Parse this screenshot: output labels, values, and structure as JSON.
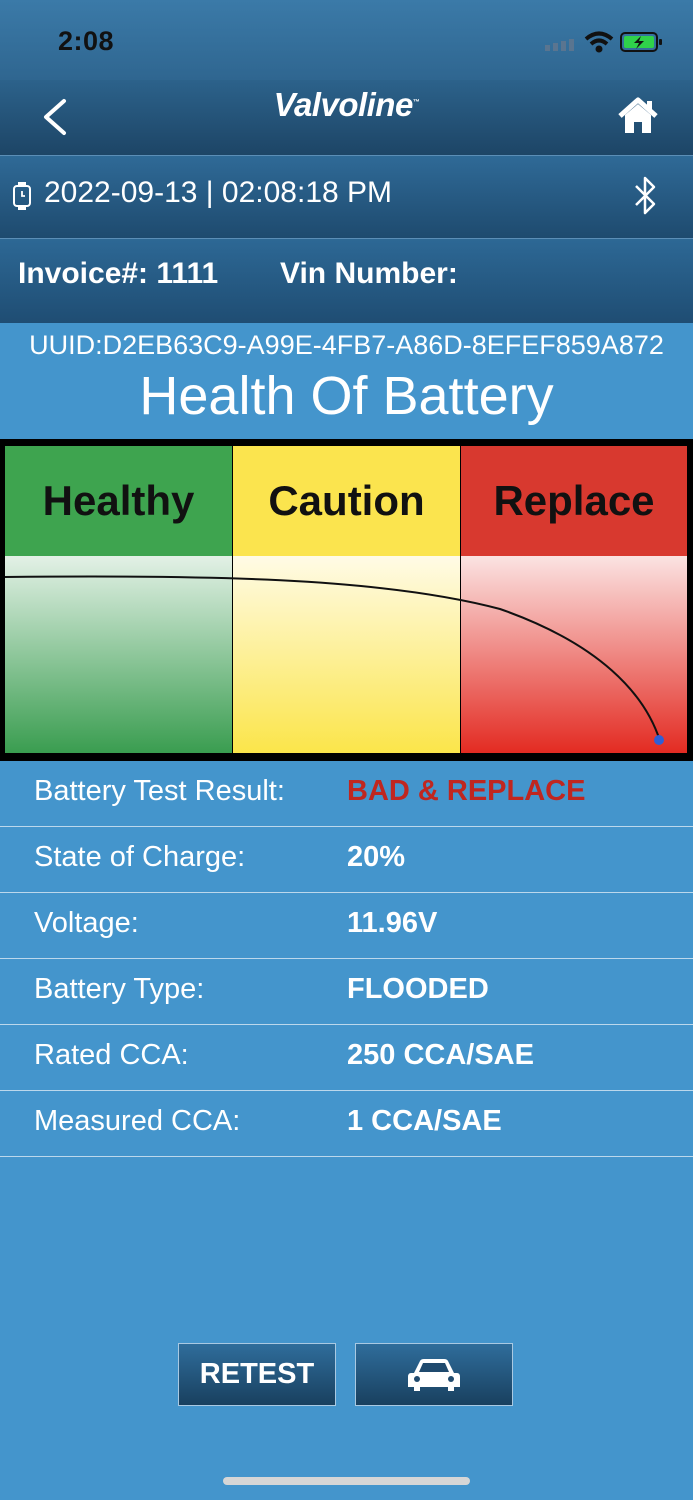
{
  "status": {
    "time": "2:08"
  },
  "header": {
    "brand": "Valvoline",
    "brand_tm": "™"
  },
  "session": {
    "datetime": "2022-09-13 | 02:08:18 PM"
  },
  "invoice": {
    "invoice_label": "Invoice#: 1111",
    "vin_label": "Vin Number:"
  },
  "device": {
    "uuid": "UUID:D2EB63C9-A99E-4FB7-A86D-8EFEF859A872"
  },
  "page": {
    "title": "Health Of Battery"
  },
  "gauge": {
    "zones": [
      "Healthy",
      "Caution",
      "Replace"
    ],
    "colors": {
      "healthy": "#3ea44f",
      "caution": "#fbe44e",
      "replace": "#d8392f",
      "marker": "#2f5fd6"
    }
  },
  "results": [
    {
      "label": "Battery Test Result:",
      "value": "BAD & REPLACE"
    },
    {
      "label": "State of Charge:",
      "value": "20%"
    },
    {
      "label": "Voltage:",
      "value": "11.96V"
    },
    {
      "label": "Battery Type:",
      "value": "FLOODED"
    },
    {
      "label": "Rated CCA:",
      "value": "250 CCA/SAE"
    },
    {
      "label": "Measured CCA:",
      "value": "1 CCA/SAE"
    }
  ],
  "actions": {
    "retest": "RETEST",
    "vehicle_icon": "car-icon"
  }
}
